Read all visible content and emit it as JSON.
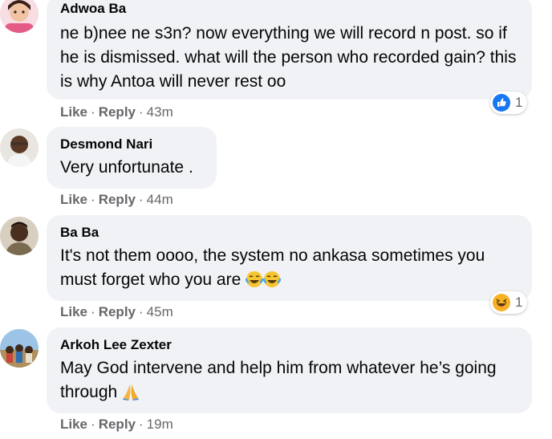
{
  "comments": [
    {
      "author": "Adwoa Ba",
      "text": "ne b)nee ne s3n? now everything we will record n post. so if he is dismissed. what will the person who recorded gain? this is why Antoa will never rest oo",
      "like": "Like",
      "reply": "Reply",
      "time": "43m",
      "reaction": {
        "icon": "like-icon",
        "count": "1",
        "color": "#1877f2"
      }
    },
    {
      "author": "Desmond Nari",
      "text": "Very unfortunate .",
      "like": "Like",
      "reply": "Reply",
      "time": "44m"
    },
    {
      "author": "Ba Ba",
      "text": "It's not them oooo, the system no ankasa sometimes you must forget who you are",
      "like": "Like",
      "reply": "Reply",
      "time": "45m",
      "emojis": [
        "tears-of-joy-emoji",
        "tears-of-joy-emoji"
      ],
      "reaction": {
        "icon": "haha-icon",
        "count": "1",
        "color": "#f7b125"
      }
    },
    {
      "author": "Arkoh Lee Zexter",
      "text": "May God intervene and help him from whatever he’s going through",
      "like": "Like",
      "reply": "Reply",
      "time": "19m",
      "emojis": [
        "praying-hands-emoji"
      ]
    }
  ],
  "separator": "·",
  "colors": {
    "bubble": "#f0f2f5",
    "meta": "#65676b",
    "text": "#050505",
    "like_blue": "#1877f2"
  }
}
